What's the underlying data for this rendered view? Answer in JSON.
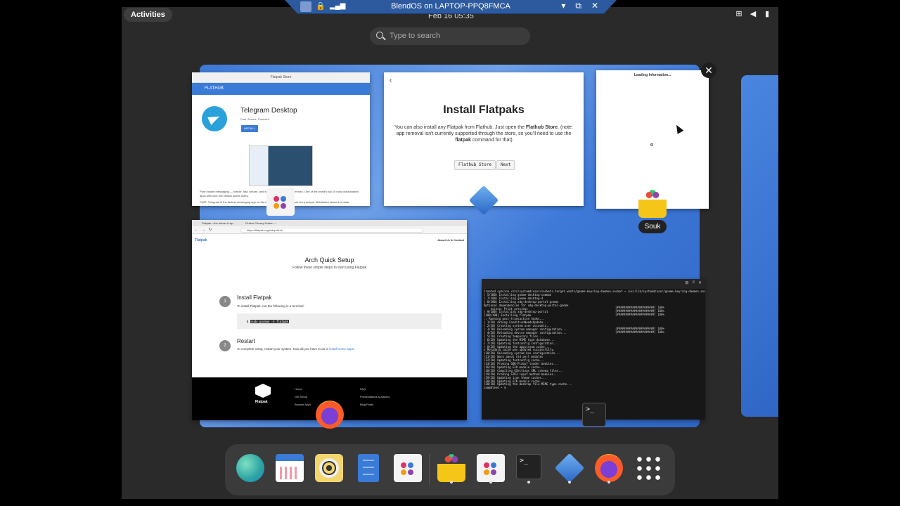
{
  "rdp": {
    "title": "BlendOS on LAPTOP-PPQ8FMCA",
    "buttons": [
      "▾",
      "⧉",
      "✕"
    ]
  },
  "topbar": {
    "activities": "Activities",
    "clock": "Feb 16  05:35"
  },
  "search": {
    "placeholder": "Type to search"
  },
  "windows": {
    "flatpak_store": {
      "title": "Flatpak Store",
      "header": "FLATHUB",
      "app_name": "Telegram Desktop",
      "tagline": "Fast. Secure. Powerful.",
      "install": "INSTALL",
      "description": "Pure instant messaging — simple, fast, secure, and synced across all your devices. One of the world's top 10 most downloaded apps with over 500 million active users.",
      "description2": "FAST: Telegram is the fastest messaging app on the market, connecting people via a unique, distributed network of data"
    },
    "install_flatpaks": {
      "back": "‹",
      "title": "Install Flatpaks",
      "body_pre": "You can also install any Flatpak from Flathub. Just open the ",
      "body_bold": "Flathub Store",
      "body_mid": ". (note: app removal isn't currently supported through the store, so you'll need to use the ",
      "body_bold2": "flatpak",
      "body_post": " command for that)",
      "btn_store": "Flathub Store",
      "btn_next": "Next"
    },
    "loading": {
      "title": "Loading Information..."
    },
    "firefox": {
      "tab1": "Flatpak—the future of ap...",
      "tab2": "Firefox Privacy Notice —",
      "url": "https://flatpak.org/setup/Arch",
      "brand": "Flatpak",
      "about": "About Us & Contact",
      "heading": "Arch Quick Setup",
      "subheading": "Follow these simple steps to start using Flatpak",
      "step1_num": "1",
      "step1_title": "Install Flatpak",
      "step1_desc": "To install Flatpak, run the following in a terminal:",
      "step1_cmd_prompt": "$",
      "step1_cmd": "sudo pacman -S flatpak",
      "step2_num": "2",
      "step2_title": "Restart",
      "step2_desc": "To complete setup, restart your system. Now all you have to do is ",
      "step2_link": "install some apps!",
      "footer_logo": "Flatpak",
      "footer_col1": [
        "Home",
        "Get Setup",
        "Browse Apps"
      ],
      "footer_col2": [
        "FAQ",
        "Presentations & Articles",
        "Blog Posts"
      ]
    },
    "terminal": {
      "lines": [
        "Created symlink /etc/systemd/user/sockets.target.wants/gnome-keyring-daemon.socket → /usr/lib/systemd/user/gnome-keyring-daemon.socket.",
        "( 5/100) Installing gnome-desktop-common",
        "( 7/100) Installing gnome-desktop-4",
        "( 8/100) Installing xdg-desktop-portal-gnome",
        "Optional dependencies for xdg-desktop-portal-gnome",
        "    evince: Print previews",
        "( 9/100) Installing xdg-desktop-portal",
        "(100/100) Installing flatpak",
        ":: Running post-transaction hooks...",
        "( 1/20) Arming ConditionNeedsUpdate...",
        "( 2/20) Creating system user accounts...",
        "( 3/20) Reloading system manager configuration...",
        "( 4/20) Reloading device manager configuration...",
        "( 5/20) Creating temporary files...",
        "( 6/20) Updating the MIME type database...",
        "( 7/20) Updating fontconfig configuration...",
        "( 8/20) Updating the appstream cache...",
        "✔ Metadata cache was updated successfully.",
        "(10/20) Reloading system bus configuration...",
        "(11/20) Warn about old perl modules",
        "(12/20) Updating fontconfig cache...",
        "(14/20) Probing GDK-Pixbuf loader modules...",
        "(16/20) Updating GIO module cache...",
        "(18/20) Compiling GSettings XML schema files...",
        "(19/20) Probing GTK3 input method modules...",
        "(19/20) Updating icon theme caches...",
        "(20/20) Updating GTK module cache...",
        "(20/20) Updating the desktop file MIME type cache...",
        "sam@blend ~ $"
      ],
      "bars": [
        "[######################] 100%",
        "[######################] 100%",
        "[######################] 100%",
        "[######################] 100%",
        "[######################] 100%"
      ]
    }
  },
  "overview_labels": {
    "souk": "Souk"
  },
  "dock": {
    "items": [
      {
        "name": "globe-icon",
        "running": false
      },
      {
        "name": "calendar-icon",
        "running": false
      },
      {
        "name": "rhythmbox-icon",
        "running": false
      },
      {
        "name": "files-icon",
        "running": false
      },
      {
        "name": "software-icon",
        "running": false
      },
      {
        "name": "souk-icon",
        "running": true
      },
      {
        "name": "flatpak-store-icon",
        "running": true
      },
      {
        "name": "terminal-icon",
        "running": true
      },
      {
        "name": "installer-icon",
        "running": true
      },
      {
        "name": "firefox-icon",
        "running": true
      },
      {
        "name": "app-grid-icon",
        "running": false
      }
    ],
    "terminal_glyph": ">_"
  },
  "colors": {
    "accent": "#3b7bd8",
    "panel": "#2a2a2a",
    "dock": "#3b3b3b"
  }
}
